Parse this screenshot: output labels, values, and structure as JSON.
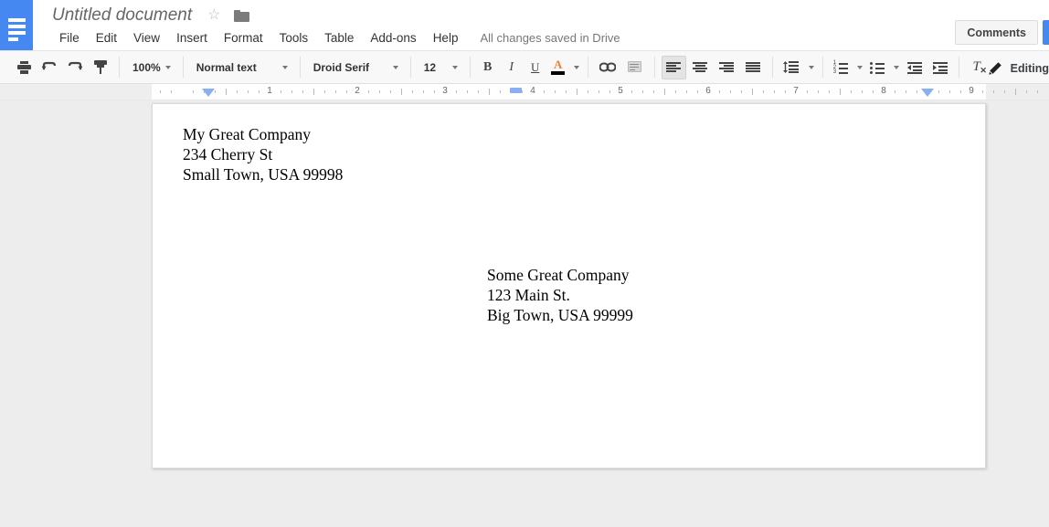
{
  "app": {
    "logo_icon": "docs-logo-icon",
    "title": "Untitled document",
    "star_icon": "star-icon",
    "folder_icon": "folder-icon",
    "save_status": "All changes saved in Drive"
  },
  "menu": {
    "items": [
      {
        "label": "File"
      },
      {
        "label": "Edit"
      },
      {
        "label": "View"
      },
      {
        "label": "Insert"
      },
      {
        "label": "Format"
      },
      {
        "label": "Tools"
      },
      {
        "label": "Table"
      },
      {
        "label": "Add-ons"
      },
      {
        "label": "Help"
      }
    ]
  },
  "header_actions": {
    "comments_label": "Comments",
    "share_color": "#4688f1"
  },
  "toolbar": {
    "print_icon": "print-icon",
    "undo_icon": "undo-icon",
    "redo_icon": "redo-icon",
    "paint_format_icon": "paint-format-icon",
    "zoom_value": "100%",
    "style_value": "Normal text",
    "font_value": "Droid Serif",
    "font_size_value": "12",
    "bold_label": "B",
    "italic_label": "I",
    "underline_label": "U",
    "text_color_label": "A",
    "text_color_value": "#000000",
    "link_icon": "link-icon",
    "comment_icon": "add-comment-icon",
    "align_left_icon": "align-left-icon",
    "align_center_icon": "align-center-icon",
    "align_right_icon": "align-right-icon",
    "align_justify_icon": "align-justify-icon",
    "line_spacing_icon": "line-spacing-icon",
    "numbered_list_icon": "numbered-list-icon",
    "bulleted_list_icon": "bulleted-list-icon",
    "decrease_indent_icon": "decrease-indent-icon",
    "increase_indent_icon": "increase-indent-icon",
    "clear_formatting_label": "T",
    "clear_formatting_icon": "clear-formatting-icon",
    "active_alignment": "left"
  },
  "mode": {
    "pencil_icon": "pencil-icon",
    "label": "Editing"
  },
  "ruler": {
    "numbers": [
      "1",
      "2",
      "3",
      "4",
      "5",
      "6",
      "7",
      "8",
      "9"
    ],
    "left_indent_position_in": 0.35,
    "right_indent_position_in": 8.5,
    "tab_stop_position_in": 3.8,
    "unit": "inches"
  },
  "document": {
    "sender": {
      "lines": [
        "My Great Company",
        "234 Cherry St",
        "Small Town, USA 99998"
      ]
    },
    "recipient": {
      "lines": [
        "Some Great Company",
        "123 Main St.",
        "Big Town, USA 99999"
      ]
    }
  }
}
